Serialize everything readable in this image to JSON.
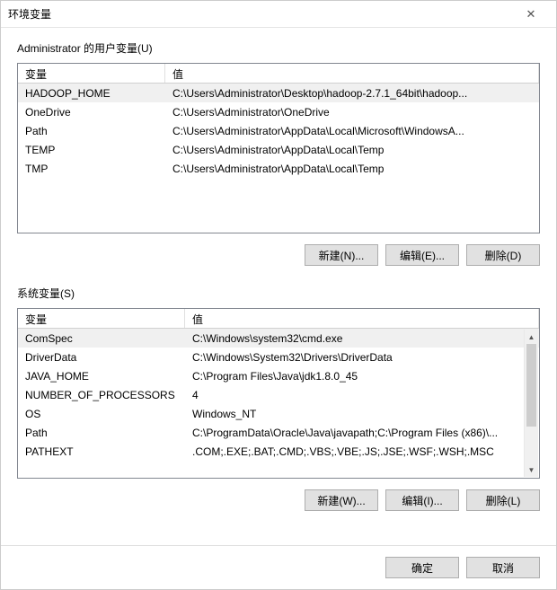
{
  "window": {
    "title": "环境变量"
  },
  "userVars": {
    "label": "Administrator 的用户变量(U)",
    "headers": {
      "name": "变量",
      "value": "值"
    },
    "rows": [
      {
        "name": "HADOOP_HOME",
        "value": "C:\\Users\\Administrator\\Desktop\\hadoop-2.7.1_64bit\\hadoop..."
      },
      {
        "name": "OneDrive",
        "value": "C:\\Users\\Administrator\\OneDrive"
      },
      {
        "name": "Path",
        "value": "C:\\Users\\Administrator\\AppData\\Local\\Microsoft\\WindowsA..."
      },
      {
        "name": "TEMP",
        "value": "C:\\Users\\Administrator\\AppData\\Local\\Temp"
      },
      {
        "name": "TMP",
        "value": "C:\\Users\\Administrator\\AppData\\Local\\Temp"
      }
    ],
    "buttons": {
      "new": "新建(N)...",
      "edit": "编辑(E)...",
      "delete": "删除(D)"
    }
  },
  "sysVars": {
    "label": "系统变量(S)",
    "headers": {
      "name": "变量",
      "value": "值"
    },
    "rows": [
      {
        "name": "ComSpec",
        "value": "C:\\Windows\\system32\\cmd.exe"
      },
      {
        "name": "DriverData",
        "value": "C:\\Windows\\System32\\Drivers\\DriverData"
      },
      {
        "name": "JAVA_HOME",
        "value": "C:\\Program Files\\Java\\jdk1.8.0_45"
      },
      {
        "name": "NUMBER_OF_PROCESSORS",
        "value": "4"
      },
      {
        "name": "OS",
        "value": "Windows_NT"
      },
      {
        "name": "Path",
        "value": "C:\\ProgramData\\Oracle\\Java\\javapath;C:\\Program Files (x86)\\..."
      },
      {
        "name": "PATHEXT",
        "value": ".COM;.EXE;.BAT;.CMD;.VBS;.VBE;.JS;.JSE;.WSF;.WSH;.MSC"
      }
    ],
    "buttons": {
      "new": "新建(W)...",
      "edit": "编辑(I)...",
      "delete": "删除(L)"
    }
  },
  "footer": {
    "ok": "确定",
    "cancel": "取消"
  }
}
